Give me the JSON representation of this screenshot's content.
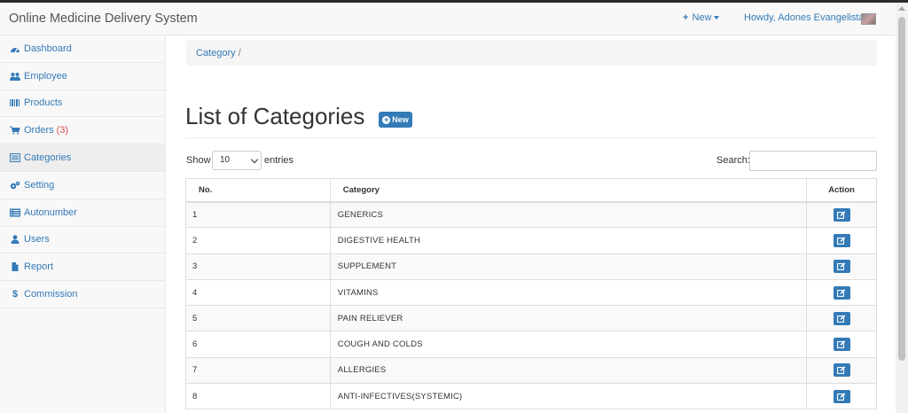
{
  "app": {
    "title": "Online Medicine Delivery System",
    "new_label": "New",
    "user_greeting": "Howdy, Adones Evangelista"
  },
  "sidebar": {
    "items": [
      {
        "label": "Dashboard",
        "icon": "dashboard-icon"
      },
      {
        "label": "Employee",
        "icon": "users-icon"
      },
      {
        "label": "Products",
        "icon": "barcode-icon"
      },
      {
        "label": "Orders",
        "icon": "cart-icon",
        "badge": "(3)"
      },
      {
        "label": "Categories",
        "icon": "list-alt-icon"
      },
      {
        "label": "Setting",
        "icon": "cogs-icon"
      },
      {
        "label": "Autonumber",
        "icon": "list-icon"
      },
      {
        "label": "Users",
        "icon": "user-icon"
      },
      {
        "label": "Report",
        "icon": "file-icon"
      },
      {
        "label": "Commission",
        "icon": "dollar-icon"
      }
    ],
    "active_index": 4
  },
  "breadcrumb": {
    "item": "Category",
    "separator": "/"
  },
  "page": {
    "title": "List of Categories",
    "new_button": "New"
  },
  "controls": {
    "show_label": "Show",
    "entries_value": "10",
    "entries_label": "entries",
    "search_label": "Search:",
    "search_value": ""
  },
  "table": {
    "headers": {
      "no": "No.",
      "category": "Category",
      "action": "Action"
    },
    "rows": [
      {
        "no": "1",
        "category": "GENERICS"
      },
      {
        "no": "2",
        "category": "DIGESTIVE HEALTH"
      },
      {
        "no": "3",
        "category": "SUPPLEMENT"
      },
      {
        "no": "4",
        "category": "VITAMINS"
      },
      {
        "no": "5",
        "category": "PAIN RELIEVER"
      },
      {
        "no": "6",
        "category": "COUGH AND COLDS"
      },
      {
        "no": "7",
        "category": "ALLERGIES"
      },
      {
        "no": "8",
        "category": "ANTI-INFECTIVES(SYSTEMIC)"
      }
    ]
  },
  "colors": {
    "accent": "#337ab7",
    "badge_red": "#d9534f"
  }
}
